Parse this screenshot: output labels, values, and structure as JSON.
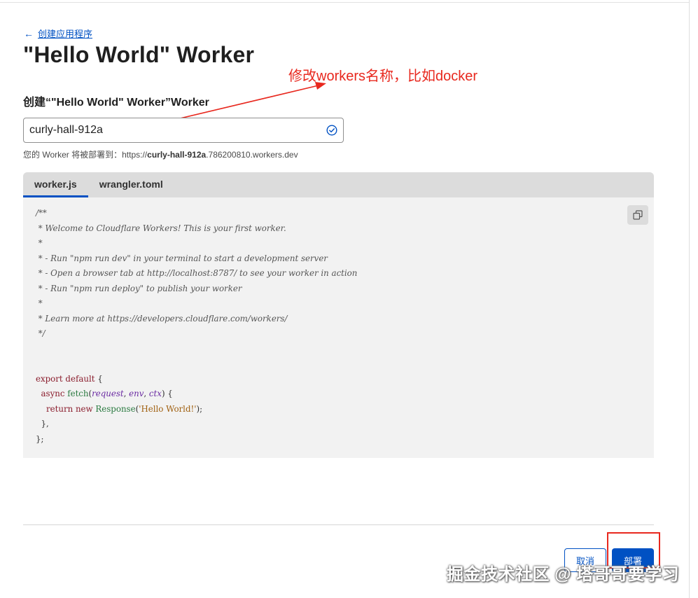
{
  "back_link": {
    "label": "创建应用程序"
  },
  "page_title": "\"Hello World\" Worker",
  "annotation": {
    "text": "修改workers名称，比如docker",
    "color": "#e8281e"
  },
  "name_field": {
    "label": "创建“\"Hello World\" Worker”Worker",
    "value": "curly-hall-912a",
    "status_icon": "check-circle-icon"
  },
  "deploy_hint": {
    "prefix": "您的 Worker 将被部署到：https://",
    "name": "curly-hall-912a",
    "suffix": ".786200810.workers.dev"
  },
  "editor": {
    "tabs": [
      {
        "label": "worker.js",
        "active": true
      },
      {
        "label": "wrangler.toml",
        "active": false
      }
    ],
    "copy_icon": "copy-icon",
    "comment_lines": [
      "/**",
      " * Welcome to Cloudflare Workers! This is your first worker.",
      " *",
      " * - Run \"npm run dev\" in your terminal to start a development server",
      " * - Open a browser tab at http://localhost:8787/ to see your worker in action",
      " * - Run \"npm run deploy\" to publish your worker",
      " *",
      " * Learn more at https://developers.cloudflare.com/workers/",
      " */"
    ],
    "code": {
      "export_kw": "export default",
      "brace_open": " {",
      "async_kw": "async",
      "fetch_fn": "fetch",
      "params": [
        "request",
        "env",
        "ctx"
      ],
      "return_kw": "return new",
      "response_fn": "Response",
      "response_str": "'Hello World!'",
      "close_inner": "},",
      "close_outer": "};"
    }
  },
  "footer": {
    "cancel_label": "取消",
    "deploy_label": "部署"
  },
  "watermark": "掘金技术社区 @ 塔哥哥要学习",
  "colors": {
    "accent": "#0051c3",
    "annotation": "#e8281e"
  }
}
